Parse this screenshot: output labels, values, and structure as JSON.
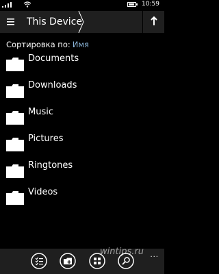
{
  "status_bar": {
    "time": "10:59",
    "icons": [
      "signal-icon",
      "wifi-icon",
      "battery-icon"
    ]
  },
  "header": {
    "breadcrumb": "This Device",
    "icons": [
      "hamburger-menu-icon",
      "up-arrow-icon"
    ]
  },
  "sort": {
    "label": "Сортировка по:",
    "value": "Имя"
  },
  "folders": [
    {
      "name": "Documents"
    },
    {
      "name": "Downloads"
    },
    {
      "name": "Music"
    },
    {
      "name": "Pictures"
    },
    {
      "name": "Ringtones"
    },
    {
      "name": "Videos"
    }
  ],
  "app_bar": {
    "buttons": [
      "select-icon",
      "add-icon",
      "view-icon",
      "search-icon"
    ],
    "more": "...",
    "watermark": "wintips.ru"
  },
  "colors": {
    "background": "#000000",
    "bar": "#1f1f1f",
    "accent": "#8ab4d8"
  }
}
